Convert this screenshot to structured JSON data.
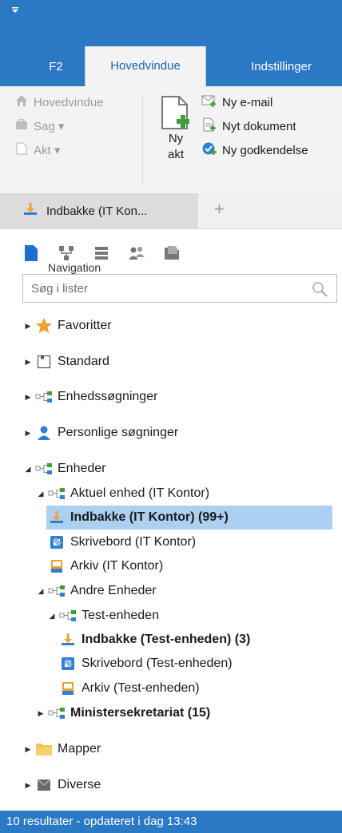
{
  "tabs": [
    {
      "label": "F2",
      "active": false
    },
    {
      "label": "Hovedvindue",
      "active": true
    },
    {
      "label": "Indstillinger",
      "active": false
    }
  ],
  "ribbon": {
    "navigation": {
      "items": [
        {
          "label": "Hovedvindue",
          "icon": "home-icon"
        },
        {
          "label": "Sag ▾",
          "icon": "case-icon"
        },
        {
          "label": "Akt ▾",
          "icon": "document-icon"
        }
      ],
      "group_label": "Navigation"
    },
    "new_akt": {
      "line1": "Ny",
      "line2": "akt"
    },
    "new_items": [
      {
        "label": "Ny e-mail",
        "icon": "new-email-icon"
      },
      {
        "label": "Nyt dokument",
        "icon": "new-document-icon"
      },
      {
        "label": "Ny godkendelse",
        "icon": "new-approval-icon"
      }
    ]
  },
  "doc_tab": {
    "label": "Indbakke (IT Kon...",
    "add": "+"
  },
  "search": {
    "placeholder": "Søg i lister"
  },
  "tree": {
    "favoritter": "Favoritter",
    "standard": "Standard",
    "enhedssogninger": "Enhedssøgninger",
    "personlige": "Personlige søgninger",
    "enheder": "Enheder",
    "aktuel_enhed": "Aktuel enhed (IT Kontor)",
    "indbakke_it": "Indbakke (IT Kontor) (99+)",
    "skrivebord_it": "Skrivebord (IT Kontor)",
    "arkiv_it": "Arkiv (IT Kontor)",
    "andre_enheder": "Andre Enheder",
    "test_enheden": "Test-enheden",
    "indbakke_test": "Indbakke (Test-enheden) (3)",
    "skrivebord_test": "Skrivebord (Test-enheden)",
    "arkiv_test": "Arkiv (Test-enheden)",
    "ministersekretariat": "Ministersekretariat (15)",
    "mapper": "Mapper",
    "diverse": "Diverse"
  },
  "status": {
    "text": "10 resultater - opdateret i dag 13:43"
  },
  "colors": {
    "accent": "#2b78c5",
    "selection": "#acd0f0",
    "icon_blue": "#1e6fd0",
    "icon_orange": "#f0a030"
  }
}
